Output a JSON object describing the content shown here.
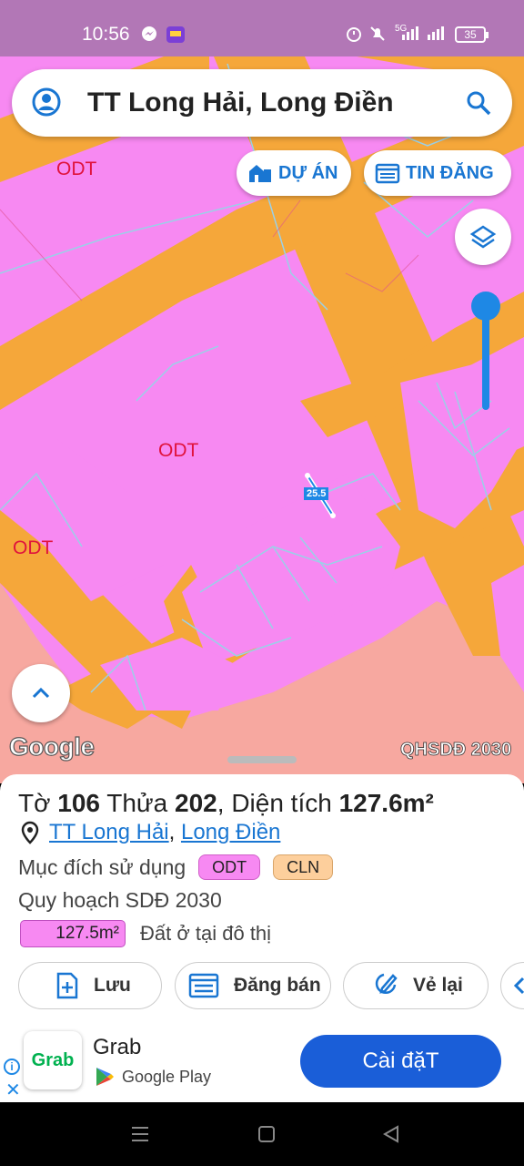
{
  "status_bar": {
    "time": "10:56",
    "battery": "35",
    "network": "5G"
  },
  "search": {
    "title": "TT Long Hải, Long Điền"
  },
  "chips": {
    "projects": "DỰ ÁN",
    "listings": "TIN ĐĂNG"
  },
  "map": {
    "labels": [
      "ODT",
      "ODT",
      "ODT",
      "ODT"
    ],
    "parcel_label": "25.5",
    "attribution": "Google",
    "plan_layer": "QHSDĐ 2030"
  },
  "sheet": {
    "sheet_label": "Tờ",
    "sheet_no": "106",
    "lot_label": "Thửa",
    "lot_no": "202",
    "area_label": "Diện tích",
    "area": "127.6m²",
    "commune": "TT Long Hải",
    "district": "Long Điền",
    "purpose_label": "Mục đích sử dụng",
    "purpose_tags": [
      "ODT",
      "CLN"
    ],
    "plan_label": "Quy hoạch SDĐ 2030",
    "plan_area": "127.5m²",
    "plan_desc": "Đất ở tại đô thị"
  },
  "actions": {
    "save": "Lưu",
    "post": "Đăng bán",
    "redraw": "Vẻ lại"
  },
  "ad": {
    "logo": "Grab",
    "name": "Grab",
    "store": "Google Play",
    "install": "Cài đặT"
  },
  "colors": {
    "odt": "#f789f2",
    "road": "#f5a73a",
    "residential": "#f7a8a0",
    "accent": "#1976d2"
  }
}
